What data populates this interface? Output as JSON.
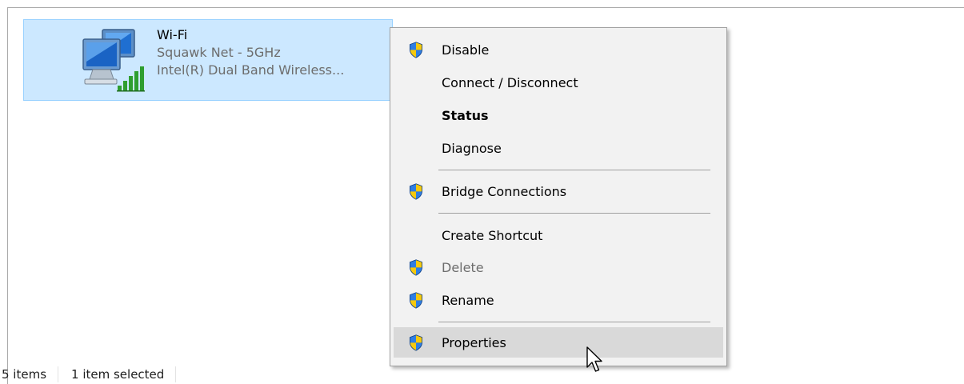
{
  "adapter": {
    "name": "Wi-Fi",
    "network": "Squawk Net - 5GHz",
    "device": "Intel(R) Dual Band Wireless..."
  },
  "status_bar": {
    "item_count": "5 items",
    "selection": "1 item selected"
  },
  "context_menu": {
    "items": [
      {
        "label": "Disable",
        "icon": "uac-shield-icon"
      },
      {
        "label": "Connect / Disconnect"
      },
      {
        "label": "Status",
        "style": "bold"
      },
      {
        "label": "Diagnose"
      },
      {
        "label": "Bridge Connections",
        "icon": "uac-shield-icon"
      },
      {
        "label": "Create Shortcut"
      },
      {
        "label": "Delete",
        "icon": "uac-shield-icon",
        "state": "disabled"
      },
      {
        "label": "Rename",
        "icon": "uac-shield-icon"
      },
      {
        "label": "Properties",
        "icon": "uac-shield-icon",
        "state": "highlighted"
      }
    ]
  },
  "colors": {
    "selection_fill": "#cce8ff",
    "selection_border": "#99d1ff",
    "menu_background": "#f2f2f2",
    "menu_highlight": "#d9d9d9",
    "disabled_text": "#6d6d6d",
    "signal_green": "#2f9e2f"
  }
}
